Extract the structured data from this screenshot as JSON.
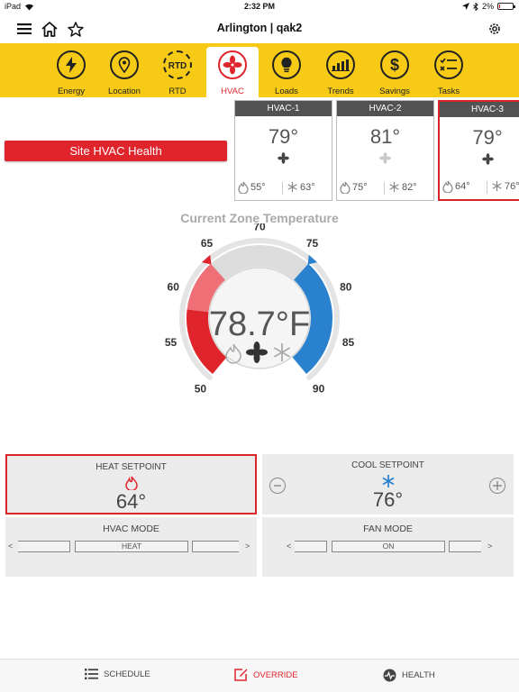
{
  "status_bar": {
    "device": "iPad",
    "time": "2:32 PM",
    "battery": "2%"
  },
  "nav": {
    "title": "Arlington | qak2"
  },
  "tabs": [
    {
      "label": "Energy",
      "icon": "lightning-icon"
    },
    {
      "label": "Location",
      "icon": "map-pin-icon"
    },
    {
      "label": "RTD",
      "icon": "rtd-icon"
    },
    {
      "label": "HVAC",
      "icon": "fan-icon",
      "active": true
    },
    {
      "label": "Loads",
      "icon": "bulb-icon"
    },
    {
      "label": "Trends",
      "icon": "bar-chart-icon"
    },
    {
      "label": "Savings",
      "icon": "dollar-icon"
    },
    {
      "label": "Tasks",
      "icon": "checklist-icon"
    }
  ],
  "site_health_label": "Site HVAC Health",
  "hvac_units": [
    {
      "name": "HVAC-1",
      "temp": "79°",
      "heat": "55°",
      "cool": "63°",
      "fan_on": true,
      "selected": false
    },
    {
      "name": "HVAC-2",
      "temp": "81°",
      "heat": "75°",
      "cool": "82°",
      "fan_on": false,
      "selected": false
    },
    {
      "name": "HVAC-3",
      "temp": "79°",
      "heat": "64°",
      "cool": "76°",
      "fan_on": true,
      "selected": true
    }
  ],
  "zone": {
    "title": "Current Zone Temperature",
    "current": "78.7°F",
    "current_value": 78.7,
    "heat_setpoint_value": 64,
    "cool_setpoint_value": 76,
    "scale": {
      "min": 50,
      "max": 90
    },
    "ticks": [
      "50",
      "55",
      "60",
      "65",
      "70",
      "75",
      "80",
      "85",
      "90"
    ]
  },
  "heat": {
    "title": "HEAT SETPOINT",
    "value": "64°"
  },
  "cool": {
    "title": "COOL SETPOINT",
    "value": "76°"
  },
  "hvac_mode": {
    "title": "HVAC MODE",
    "selected": "HEAT",
    "prev": "<",
    "next": ">"
  },
  "fan_mode": {
    "title": "FAN MODE",
    "selected": "ON",
    "prev": "<",
    "next": ">"
  },
  "bottom_tabs": [
    {
      "label": "SCHEDULE",
      "icon": "list-icon"
    },
    {
      "label": "OVERRIDE",
      "icon": "edit-icon",
      "active": true
    },
    {
      "label": "HEALTH",
      "icon": "pulse-icon"
    }
  ],
  "colors": {
    "accent": "#e0242c",
    "yellow": "#f7cb15",
    "heat": "#e0242c",
    "cool": "#2a82cf",
    "card_header": "#525252"
  }
}
